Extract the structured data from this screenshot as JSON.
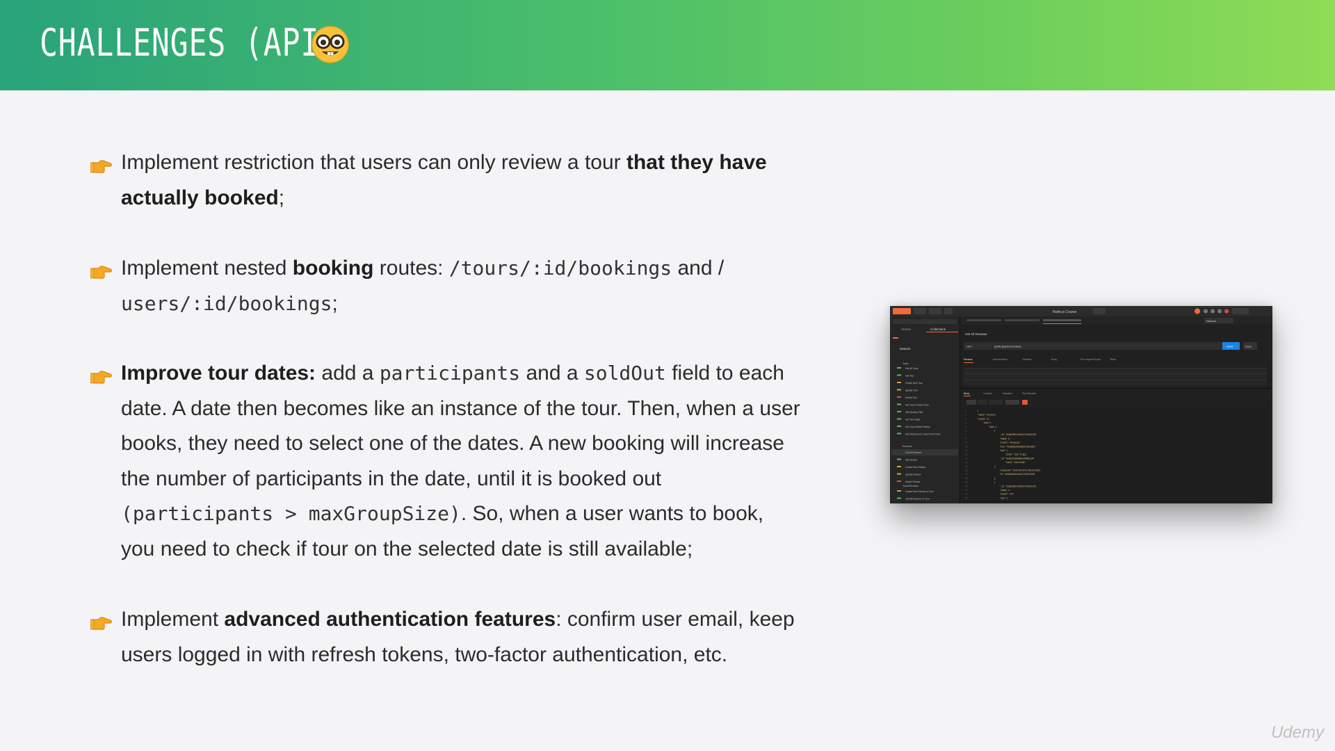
{
  "header": {
    "title": "CHALLENGES (API)",
    "emoji_icon": "nerd-face-icon",
    "gradient_start": "#28a37a",
    "gradient_end": "#8fdc55"
  },
  "bullets": [
    {
      "icon": "pointing-hand-icon",
      "line1_pre": "Implement restriction that users can only review a tour ",
      "line1_bold": "that they have",
      "line2_bold": "actually booked",
      "line2_post": ";"
    },
    {
      "icon": "pointing-hand-icon",
      "pre": "Implement nested ",
      "bold": "booking",
      "mid": " routes: ",
      "code1": "/tours/:id/bookings",
      "and": " and /",
      "code2": "users/:id/bookings",
      "post": ";"
    },
    {
      "icon": "pointing-hand-icon",
      "bold": "Improve tour dates:",
      "t1": " add a ",
      "code1": "participants",
      "t2": " and a ",
      "code2": "soldOut",
      "t3": " field to each",
      "line2": "date. A date then becomes like an instance of the tour. Then, when a user",
      "line3": "books, they need to select one of the dates. A new booking will increase",
      "line4": "the number of participants in the date, until it is booked out",
      "code3": "(participants > maxGroupSize)",
      "t5": ". So, when a user wants to book,",
      "line6": "you need to check if tour on the selected date is still available;"
    },
    {
      "icon": "pointing-hand-icon",
      "pre": "Implement ",
      "bold": "advanced authentication features",
      "post": ": confirm user email, keep",
      "line2": "users logged in with refresh tokens, two-factor authentication, etc."
    }
  ],
  "screenshot": {
    "app_title": "Node.js Course",
    "env": "Natours",
    "request_name": "Get All Reviews",
    "method": "GET",
    "url": "{{URL}}api/v1/reviews",
    "send_label": "Send",
    "save_label": "Save",
    "tabs": [
      "Params",
      "Authorization",
      "Headers",
      "Body",
      "Pre-request Script",
      "Tests"
    ],
    "response_tabs": [
      "Body",
      "Cookies",
      "Headers",
      "Test Results"
    ],
    "sidebar_tabs": [
      "History",
      "Collections"
    ],
    "collection": "Natours",
    "folders": [
      "Tours",
      "Reviews",
      "Tours/Reviews"
    ],
    "sidebar_items": [
      "Get All Tours",
      "Get Tour",
      "Create New Tour",
      "Update Tour",
      "Delete Tour",
      "Get Top 5 Cheap Tours",
      "Get Monthly Plan",
      "Get Tour Stats",
      "Get Tours Within Radius",
      "Get Distances to Tours From Point",
      "Get All Reviews",
      "Get Review",
      "Create New Review",
      "Update Review",
      "Delete Review",
      "Create New Review on Tour",
      "Get All Reviews on Tour"
    ],
    "json_lines": [
      "{",
      "\"status\": \"success\",",
      "\"results\": 11,",
      "\"data\": {",
      "\"data\": [",
      "{",
      "\"_id\": \"5c8a355b14eb5c17645c9108\",",
      "\"rating\": 5,",
      "\"review\": \"Amazing!\",",
      "\"tour\": \"5c88fa8cf4afda39709c2955\",",
      "\"user\": {",
      "\"photo\": \"user-17.jpg\",",
      "\"_id\": \"5c8a1f292f8fb814b56fa184\",",
      "\"name\": \"Max Smith\"",
      "},",
      "\"createdAt\": \"2019-05-04T14:48:26.298Z\",",
      "\"id\": \"5c8a355b14eb5c17645c9108\"",
      "},",
      "{",
      "\"_id\": \"5c8a35b614eb5c17645c910b\",",
      "\"rating\": 4,",
      "\"review\": \"OK\",",
      "\"user\": {"
    ]
  },
  "watermark": "Udemy"
}
